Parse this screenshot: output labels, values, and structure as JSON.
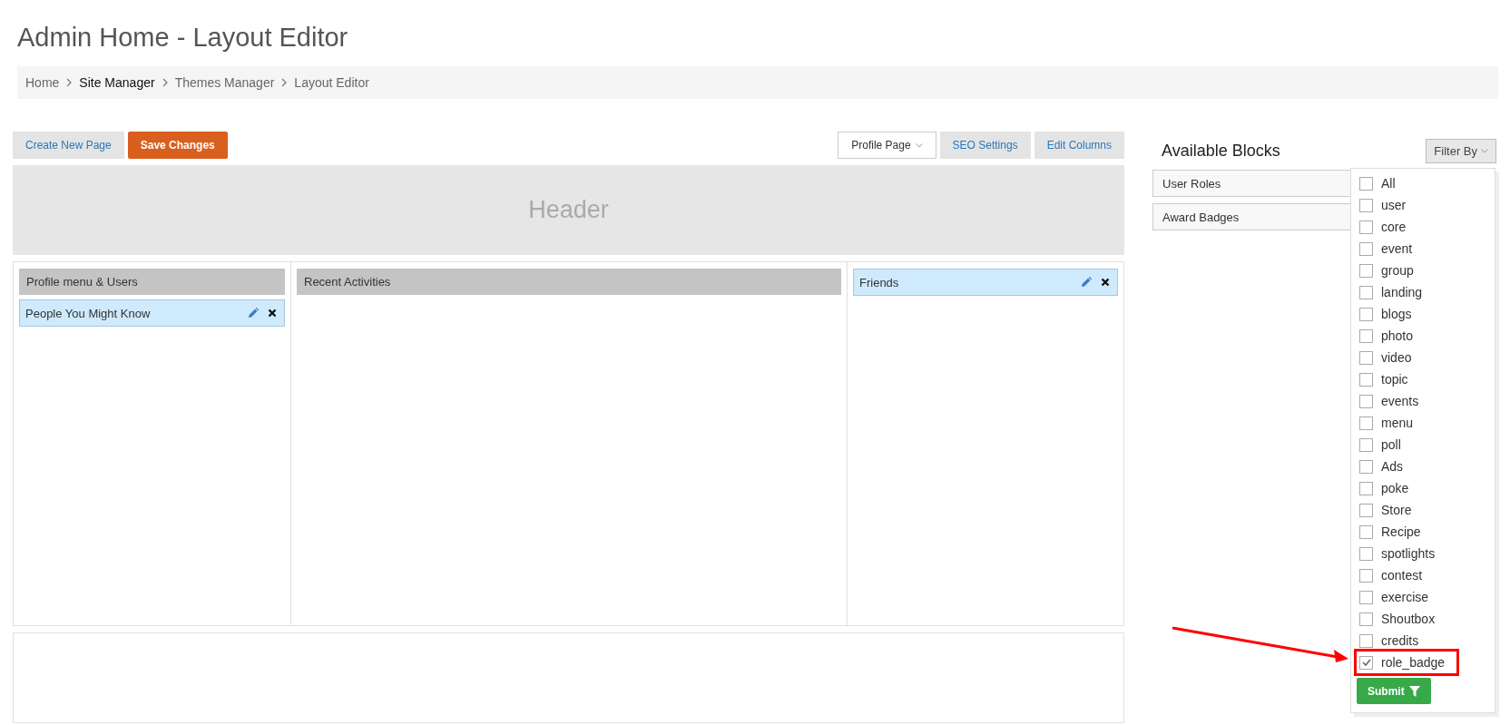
{
  "page_title": "Admin Home - Layout Editor",
  "breadcrumb": [
    {
      "label": "Home",
      "current": false
    },
    {
      "label": "Site Manager",
      "current": true
    },
    {
      "label": "Themes Manager",
      "current": false
    },
    {
      "label": "Layout Editor",
      "current": false
    }
  ],
  "toolbar": {
    "left_buttons": [
      {
        "label": "Create New Page",
        "kind": "plain"
      },
      {
        "label": "Save Changes",
        "kind": "primary"
      }
    ],
    "page_select": "Profile Page",
    "right_buttons": [
      "SEO Settings",
      "Edit Columns"
    ]
  },
  "header_area": "Header",
  "columns": [
    {
      "title": "Profile menu & Users",
      "blocks": [
        "People You Might Know"
      ]
    },
    {
      "title": "Recent Activities"
    },
    {
      "blocks": [
        "Friends"
      ]
    }
  ],
  "available_blocks": {
    "title": "Available Blocks",
    "items": [
      "User Roles",
      "Award Badges"
    ]
  },
  "filter": {
    "button": "Filter By",
    "options": [
      {
        "label": "All",
        "checked": false,
        "highlighted": false
      },
      {
        "label": "user",
        "checked": false,
        "highlighted": false
      },
      {
        "label": "core",
        "checked": false,
        "highlighted": false
      },
      {
        "label": "event",
        "checked": false,
        "highlighted": false
      },
      {
        "label": "group",
        "checked": false,
        "highlighted": false
      },
      {
        "label": "landing",
        "checked": false,
        "highlighted": false
      },
      {
        "label": "blogs",
        "checked": false,
        "highlighted": false
      },
      {
        "label": "photo",
        "checked": false,
        "highlighted": false
      },
      {
        "label": "video",
        "checked": false,
        "highlighted": false
      },
      {
        "label": "topic",
        "checked": false,
        "highlighted": false
      },
      {
        "label": "events",
        "checked": false,
        "highlighted": false
      },
      {
        "label": "menu",
        "checked": false,
        "highlighted": false
      },
      {
        "label": "poll",
        "checked": false,
        "highlighted": false
      },
      {
        "label": "Ads",
        "checked": false,
        "highlighted": false
      },
      {
        "label": "poke",
        "checked": false,
        "highlighted": false
      },
      {
        "label": "Store",
        "checked": false,
        "highlighted": false
      },
      {
        "label": "Recipe",
        "checked": false,
        "highlighted": false
      },
      {
        "label": "spotlights",
        "checked": false,
        "highlighted": false
      },
      {
        "label": "contest",
        "checked": false,
        "highlighted": false
      },
      {
        "label": "exercise",
        "checked": false,
        "highlighted": false
      },
      {
        "label": "Shoutbox",
        "checked": false,
        "highlighted": false
      },
      {
        "label": "credits",
        "checked": false,
        "highlighted": false
      },
      {
        "label": "role_badge",
        "checked": true,
        "highlighted": true
      }
    ],
    "submit": "Submit"
  }
}
